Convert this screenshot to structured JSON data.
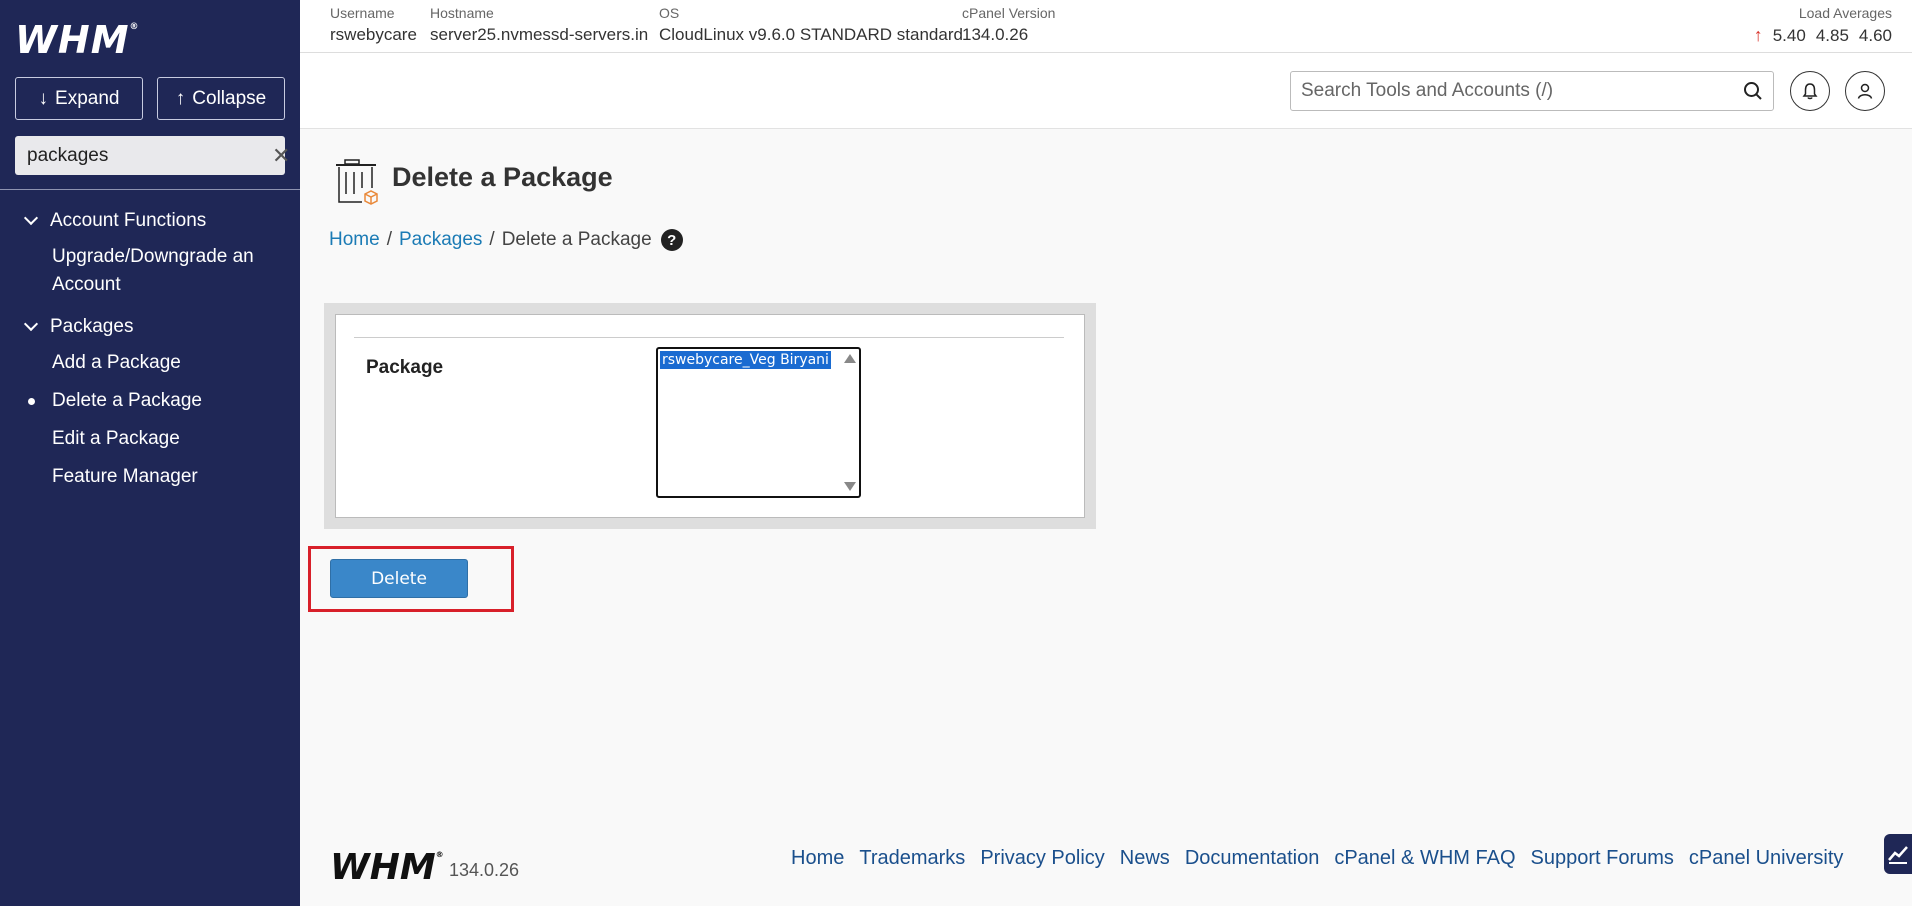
{
  "sidebar": {
    "logo": "WHM",
    "expand_label": "Expand",
    "collapse_label": "Collapse",
    "search_value": "packages",
    "groups": [
      {
        "label": "Account Functions",
        "items": [
          {
            "label": "Upgrade/Downgrade an Account",
            "active": false
          }
        ]
      },
      {
        "label": "Packages",
        "items": [
          {
            "label": "Add a Package",
            "active": false
          },
          {
            "label": "Delete a Package",
            "active": true
          },
          {
            "label": "Edit a Package",
            "active": false
          },
          {
            "label": "Feature Manager",
            "active": false
          }
        ]
      }
    ]
  },
  "server_info": {
    "username_label": "Username",
    "username": "rswebycare",
    "hostname_label": "Hostname",
    "hostname": "server25.nvmessd-servers.in",
    "os_label": "OS",
    "os": "CloudLinux v9.6.0 STANDARD standard",
    "cpanel_label": "cPanel Version",
    "cpanel_version": "134.0.26",
    "load_label": "Load Averages",
    "load": [
      "5.40",
      "4.85",
      "4.60"
    ]
  },
  "search": {
    "placeholder": "Search Tools and Accounts (/)"
  },
  "page": {
    "title": "Delete a Package",
    "breadcrumb": {
      "home": "Home",
      "packages": "Packages",
      "current": "Delete a Package"
    }
  },
  "form": {
    "package_label": "Package",
    "options": [
      "rswebycare_Veg Biryani"
    ],
    "selected": "rswebycare_Veg Biryani",
    "delete_label": "Delete"
  },
  "footer": {
    "logo": "WHM",
    "version": "134.0.26",
    "links": [
      "Home",
      "Trademarks",
      "Privacy Policy",
      "News",
      "Documentation",
      "cPanel & WHM FAQ",
      "Support Forums",
      "cPanel University"
    ]
  },
  "colors": {
    "sidebar_bg": "#1f2756",
    "link": "#1b7bb5",
    "button": "#3a87c9",
    "highlight": "#d8202a",
    "load_up": "#d9342b"
  }
}
